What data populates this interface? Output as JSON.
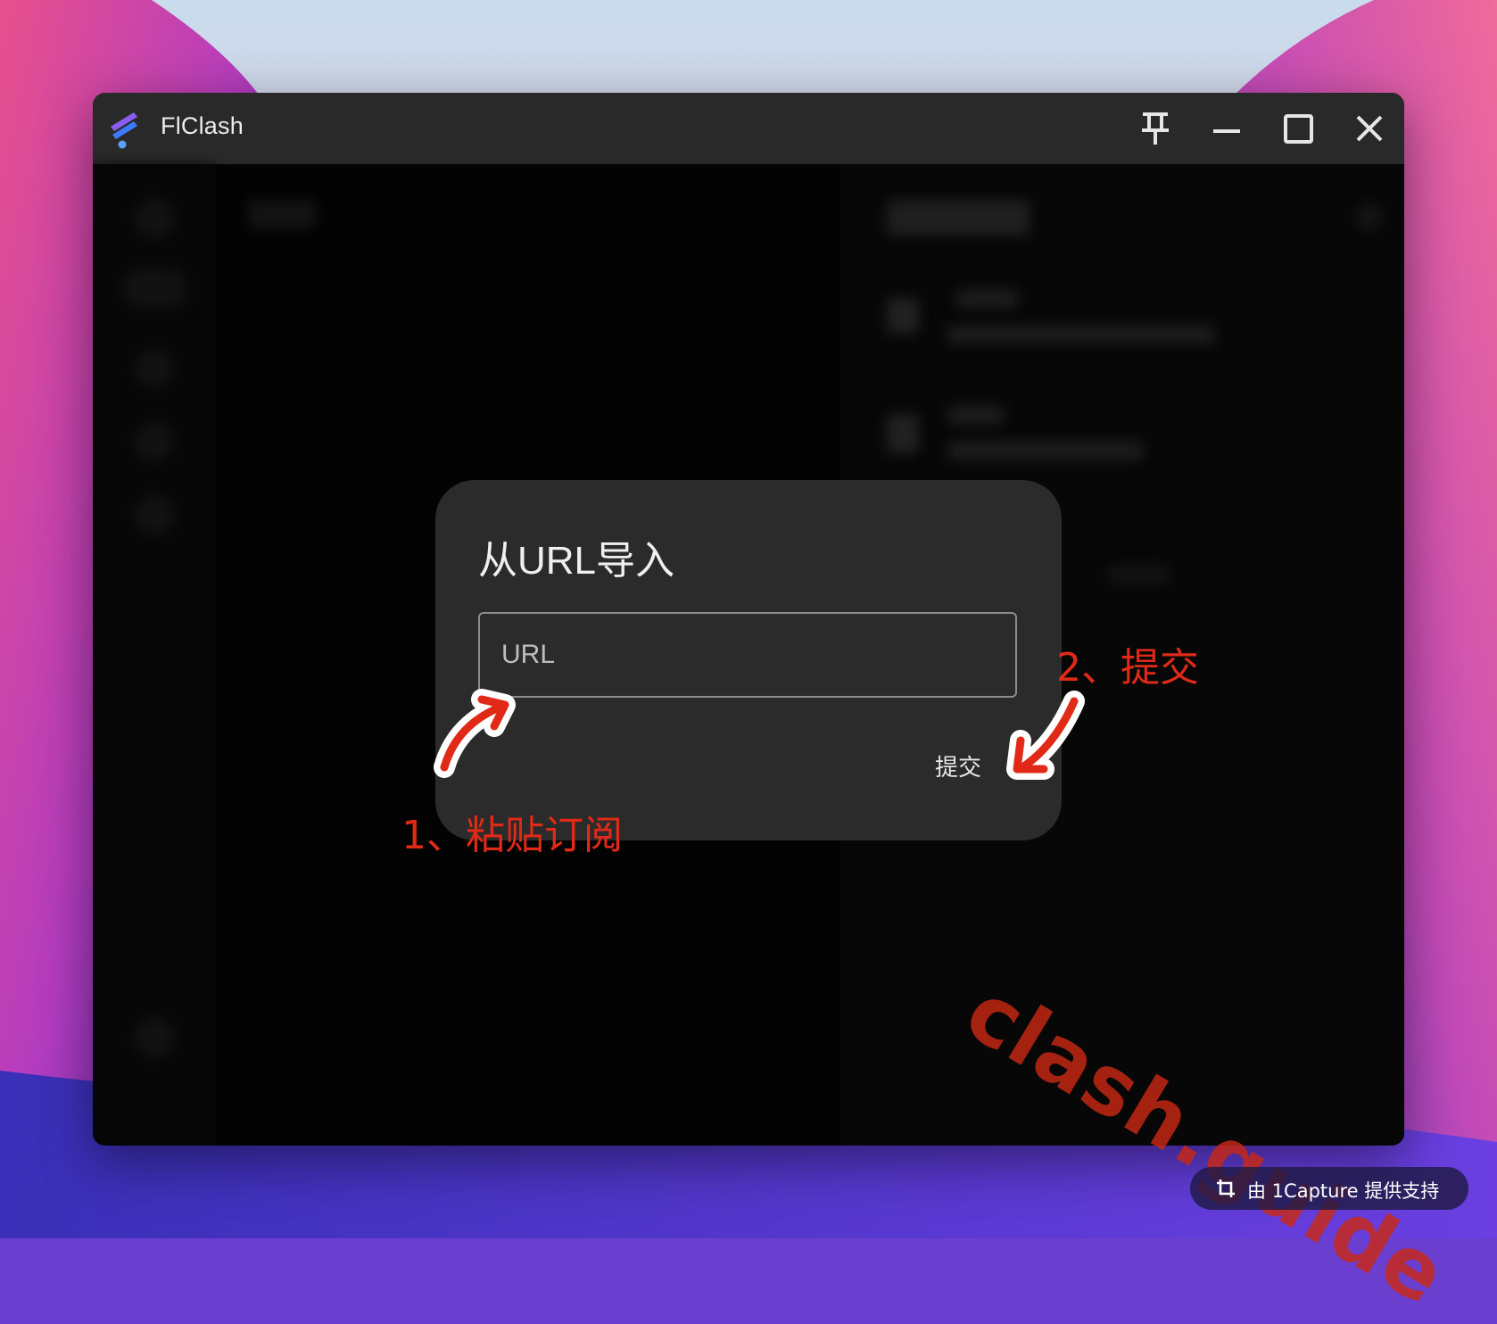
{
  "window": {
    "app_title": "FlClash",
    "controls": {
      "pin_icon": "pin-icon",
      "minimize_icon": "minimize-icon",
      "maximize_icon": "maximize-icon",
      "close_icon": "close-icon"
    }
  },
  "dialog": {
    "title": "从URL导入",
    "url_input": {
      "placeholder": "URL",
      "value": ""
    },
    "submit_label": "提交"
  },
  "annotations": {
    "step1": "1、粘贴订阅",
    "step2": "2、提交",
    "color": "#e02a17"
  },
  "watermark": "clash.guide",
  "capture_badge": {
    "text": "由 1Capture 提供支持",
    "icon": "crop-icon"
  },
  "colors": {
    "title_bar": "#2a2929",
    "dialog_bg": "#2c2b2b",
    "content_bg": "#070707",
    "logo_blue": "#3a7bff",
    "logo_purple": "#8a5cf0"
  }
}
